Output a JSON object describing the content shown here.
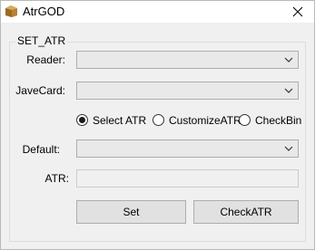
{
  "window": {
    "title": "AtrGOD",
    "icon": "package-icon"
  },
  "group": {
    "title": "SET_ATR"
  },
  "reader": {
    "label": "Reader:",
    "value": ""
  },
  "javecard": {
    "label": "JaveCard:",
    "value": ""
  },
  "mode": {
    "options": [
      {
        "label": "Select ATR",
        "checked": true
      },
      {
        "label": "CustomizeATR",
        "checked": false
      },
      {
        "label": "CheckBin",
        "checked": false
      }
    ]
  },
  "default": {
    "label": "Default:",
    "value": ""
  },
  "atr": {
    "label": "ATR:",
    "value": ""
  },
  "buttons": {
    "set": "Set",
    "check_atr": "CheckATR"
  },
  "colors": {
    "window_bg": "#f0f0f0",
    "titlebar_bg": "#ffffff",
    "icon_brown": "#b07a2e"
  }
}
